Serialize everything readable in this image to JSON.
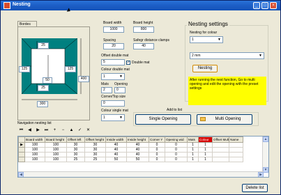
{
  "window": {
    "title": "Nesting"
  },
  "tab": {
    "label": "Bordes"
  },
  "diagram": {
    "dim_top_25": "25",
    "dim_left_125": "125",
    "dim_right_125": "125",
    "dim_50": "50",
    "dim_bottom_25": "25",
    "dim_400": "400",
    "dim_300": "300"
  },
  "board": {
    "width_label": "Board width",
    "width_value": "1000",
    "height_label": "Board height",
    "height_value": "800",
    "spacing_label": "Spacing",
    "spacing_value": "20",
    "safegr_label": "Safegr distance clamps",
    "safegr_value": "40"
  },
  "mat": {
    "offset_label": "Offset double mat",
    "offset_value": "5",
    "double_mat_label": "Double mat",
    "double_mat_checked": "✓",
    "colour_double_label": "Colour double mat",
    "colour_double_value": "1",
    "mats_label": "Mats",
    "mats_value": "2",
    "opening_label": "Opening",
    "opening_value": "0",
    "corner_label": "Corner/Top size",
    "corner_value": "0",
    "colour_single_label": "Colour single mat",
    "colour_single_value": "1"
  },
  "add": {
    "title": "Add to list",
    "single_label": "Single Opening",
    "multi_label": "Multi Opening"
  },
  "settings": {
    "title": "Nesting settings",
    "colour_label": "Nesting for colour",
    "colour_value": "1",
    "size_value": "2 mm",
    "nesting_button": "Nesting",
    "info_text": "After running the nest function, Go to multi opening and edit the opening with the preset settings"
  },
  "navigation": {
    "label": "Navigation  nesting list",
    "icons": [
      "first-icon",
      "prev-icon",
      "next-icon",
      "last-icon",
      "add-icon",
      "delete-icon",
      "edit-icon",
      "post-icon",
      "cancel-icon"
    ]
  },
  "grid": {
    "columns": [
      "Board width",
      "Board height",
      "Offset left",
      "Offset height",
      "Inside width",
      "Inside height",
      "Corner Y",
      "Opening wid",
      "Mats",
      "Colour",
      "Offset Mult",
      "Name"
    ],
    "rows": [
      [
        "100",
        "100",
        "30",
        "30",
        "40",
        "40",
        "0",
        "0",
        "1",
        "1"
      ],
      [
        "100",
        "100",
        "30",
        "30",
        "40",
        "40",
        "0",
        "0",
        "1",
        "1"
      ],
      [
        "100",
        "100",
        "30",
        "30",
        "40",
        "40",
        "0",
        "0",
        "1",
        "1"
      ],
      [
        "100",
        "100",
        "25",
        "25",
        "50",
        "50",
        "0",
        "0",
        "1",
        "1"
      ]
    ]
  },
  "delete_button": "Delete list",
  "colors": {
    "title_bar": "#1d5fc7",
    "highlight": "#ffff00",
    "diagram_mat": "#008080",
    "red_header": "#d80000"
  }
}
